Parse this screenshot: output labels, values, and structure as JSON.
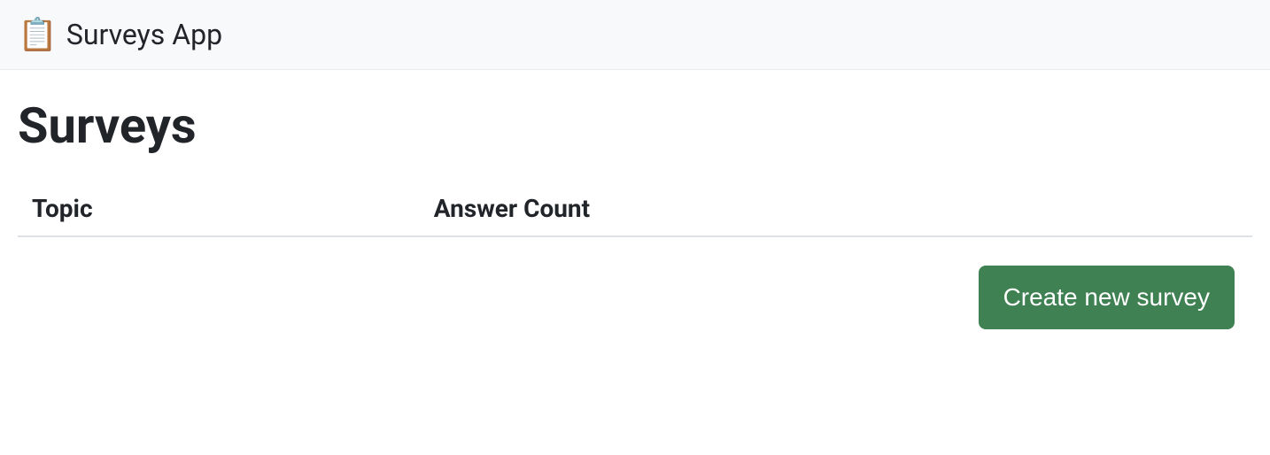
{
  "navbar": {
    "icon": "📋",
    "brand_label": "Surveys App"
  },
  "page": {
    "title": "Surveys"
  },
  "table": {
    "columns": [
      "Topic",
      "Answer Count"
    ],
    "rows": []
  },
  "actions": {
    "create_label": "Create new survey"
  },
  "colors": {
    "navbar_bg": "#f8f9fa",
    "button_bg": "#3f8152",
    "text": "#212529",
    "border": "#dee2e6"
  }
}
